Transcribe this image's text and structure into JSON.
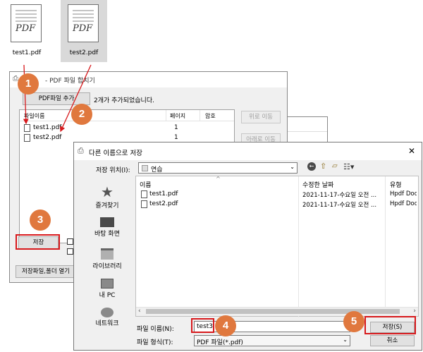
{
  "desktop": {
    "files": [
      {
        "name": "test1.pdf",
        "icon": "pdf-file-icon",
        "icon_text": "PDF"
      },
      {
        "name": "test2.pdf",
        "icon": "pdf-file-icon",
        "icon_text": "PDF"
      }
    ]
  },
  "merge_window": {
    "title": "- PDF 파일 합치기",
    "add_button": "PDF파일 추가",
    "status": "2개가 추가되었습니다.",
    "columns": [
      "파일이름",
      "페이지",
      "암호"
    ],
    "rows": [
      {
        "name": "test1.pdf",
        "pages": "1",
        "pw": ""
      },
      {
        "name": "test2.pdf",
        "pages": "1",
        "pw": ""
      }
    ],
    "move_up_button": "위로 이동",
    "move_down_button": "아래로 이동",
    "save_button": "저장",
    "open_folder_button": "저장파일,폴더 열기"
  },
  "save_dialog": {
    "title": "다른 이름으로 저장",
    "location_label": "저장 위치(I):",
    "location_value": "연습",
    "nav": [
      {
        "label": "즐겨찾기",
        "icon": "star-icon"
      },
      {
        "label": "바탕 화면",
        "icon": "desktop-icon"
      },
      {
        "label": "라이브러리",
        "icon": "library-icon"
      },
      {
        "label": "내 PC",
        "icon": "pc-icon"
      },
      {
        "label": "네트워크",
        "icon": "network-icon"
      }
    ],
    "columns": {
      "name": "이름",
      "date": "수정한 날짜",
      "type": "유형"
    },
    "files": [
      {
        "name": "test1.pdf",
        "date": "2021-11-17-수요일 오전 ...",
        "type": "Hpdf Doc"
      },
      {
        "name": "test2.pdf",
        "date": "2021-11-17-수요일 오전 ...",
        "type": "Hpdf Doc"
      }
    ],
    "filename_label": "파일 이름(N):",
    "filename_value": "test3",
    "filetype_label": "파일 형식(T):",
    "filetype_value": "PDF 파일(*.pdf)",
    "save_button": "저장(S)",
    "cancel_button": "취소",
    "close_glyph": "✕"
  },
  "callouts": [
    "1",
    "2",
    "3",
    "4",
    "5"
  ],
  "colors": {
    "callout": "#e0783e",
    "highlight": "#d7191c",
    "selection": "#cce8ff"
  }
}
